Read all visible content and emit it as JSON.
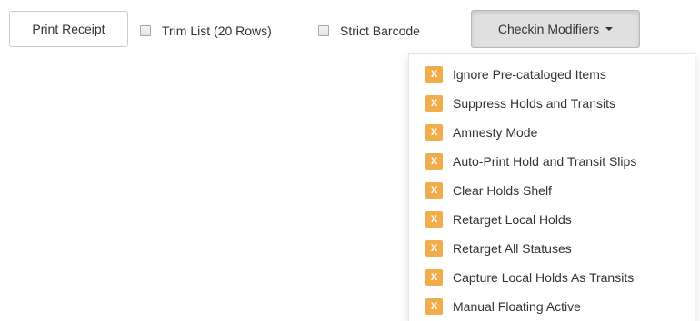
{
  "toolbar": {
    "print_receipt_label": "Print Receipt",
    "trim_list_label": "Trim List (20 Rows)",
    "trim_list_checked": false,
    "strict_barcode_label": "Strict Barcode",
    "strict_barcode_checked": false,
    "checkin_modifiers_label": "Checkin Modifiers",
    "dropdown_icon": "caret-down-icon"
  },
  "modifiers_menu": {
    "item_icon": "x-mark-icon",
    "icon_glyph": "X",
    "icon_color": "#f0ad4e",
    "items": [
      {
        "label": "Ignore Pre-cataloged Items"
      },
      {
        "label": "Suppress Holds and Transits"
      },
      {
        "label": "Amnesty Mode"
      },
      {
        "label": "Auto-Print Hold and Transit Slips"
      },
      {
        "label": "Clear Holds Shelf"
      },
      {
        "label": "Retarget Local Holds"
      },
      {
        "label": "Retarget All Statuses"
      },
      {
        "label": "Capture Local Holds As Transits"
      },
      {
        "label": "Manual Floating Active"
      }
    ]
  }
}
